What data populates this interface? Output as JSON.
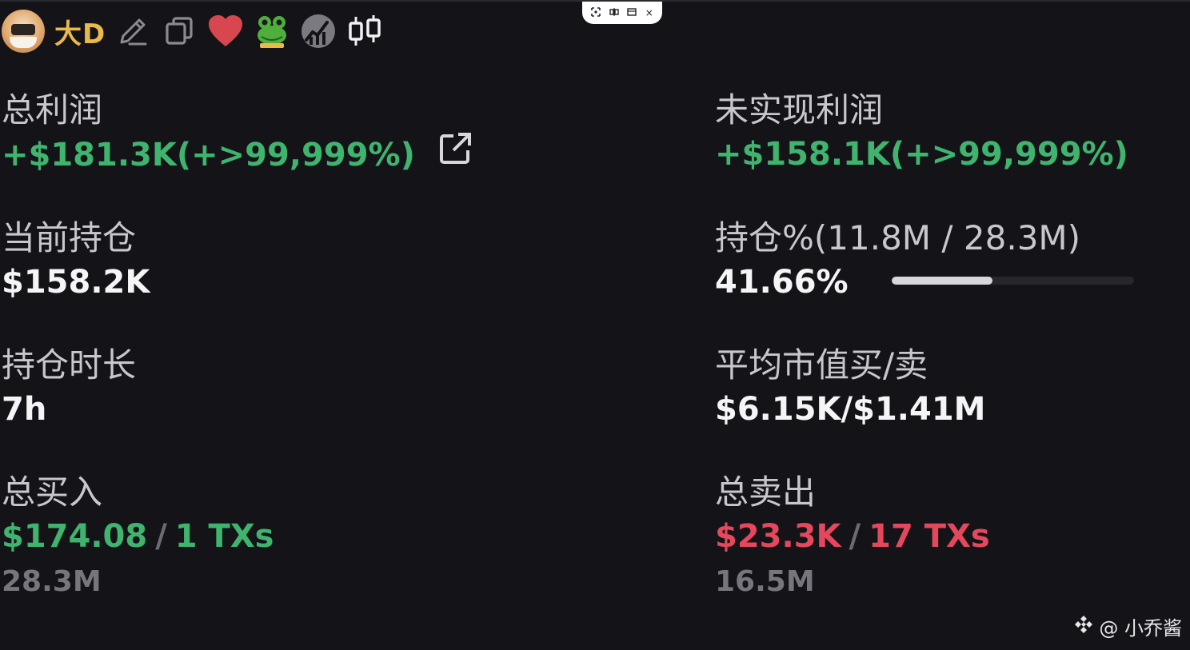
{
  "header": {
    "username": "大D",
    "icons": [
      "avatar",
      "edit-icon",
      "copy-icon",
      "heart-icon",
      "frog-icon",
      "chart-logo-icon",
      "candlestick-icon"
    ]
  },
  "float_bar": {
    "items": [
      "expand-icon",
      "split-icon",
      "window-icon",
      "close-icon"
    ],
    "close_glyph": "×"
  },
  "stats": {
    "total_profit": {
      "label": "总利润",
      "value": "+$181.3K(+>99,999%)"
    },
    "unrealized_profit": {
      "label": "未实现利润",
      "value": "+$158.1K(+>99,999%)"
    },
    "current_position": {
      "label": "当前持仓",
      "value": "$158.2K"
    },
    "position_pct": {
      "label": "持仓%(11.8M / 28.3M)",
      "value": "41.66%",
      "fraction": 0.4166
    },
    "hold_duration": {
      "label": "持仓时长",
      "value": "7h"
    },
    "avg_mcap": {
      "label": "平均市值买/卖",
      "value": "$6.15K/$1.41M"
    },
    "total_buy": {
      "label": "总买入",
      "amount": "$174.08",
      "separator": "/",
      "txs": "1 TXs",
      "tokens": "28.3M"
    },
    "total_sell": {
      "label": "总卖出",
      "amount": "$23.3K",
      "separator": "/",
      "txs": "17 TXs",
      "tokens": "16.5M"
    }
  },
  "watermark": {
    "text": "@ 小乔酱"
  },
  "colors": {
    "background": "#141418",
    "positive": "#3fb46e",
    "negative": "#e5485d",
    "username": "#e9b94a"
  }
}
